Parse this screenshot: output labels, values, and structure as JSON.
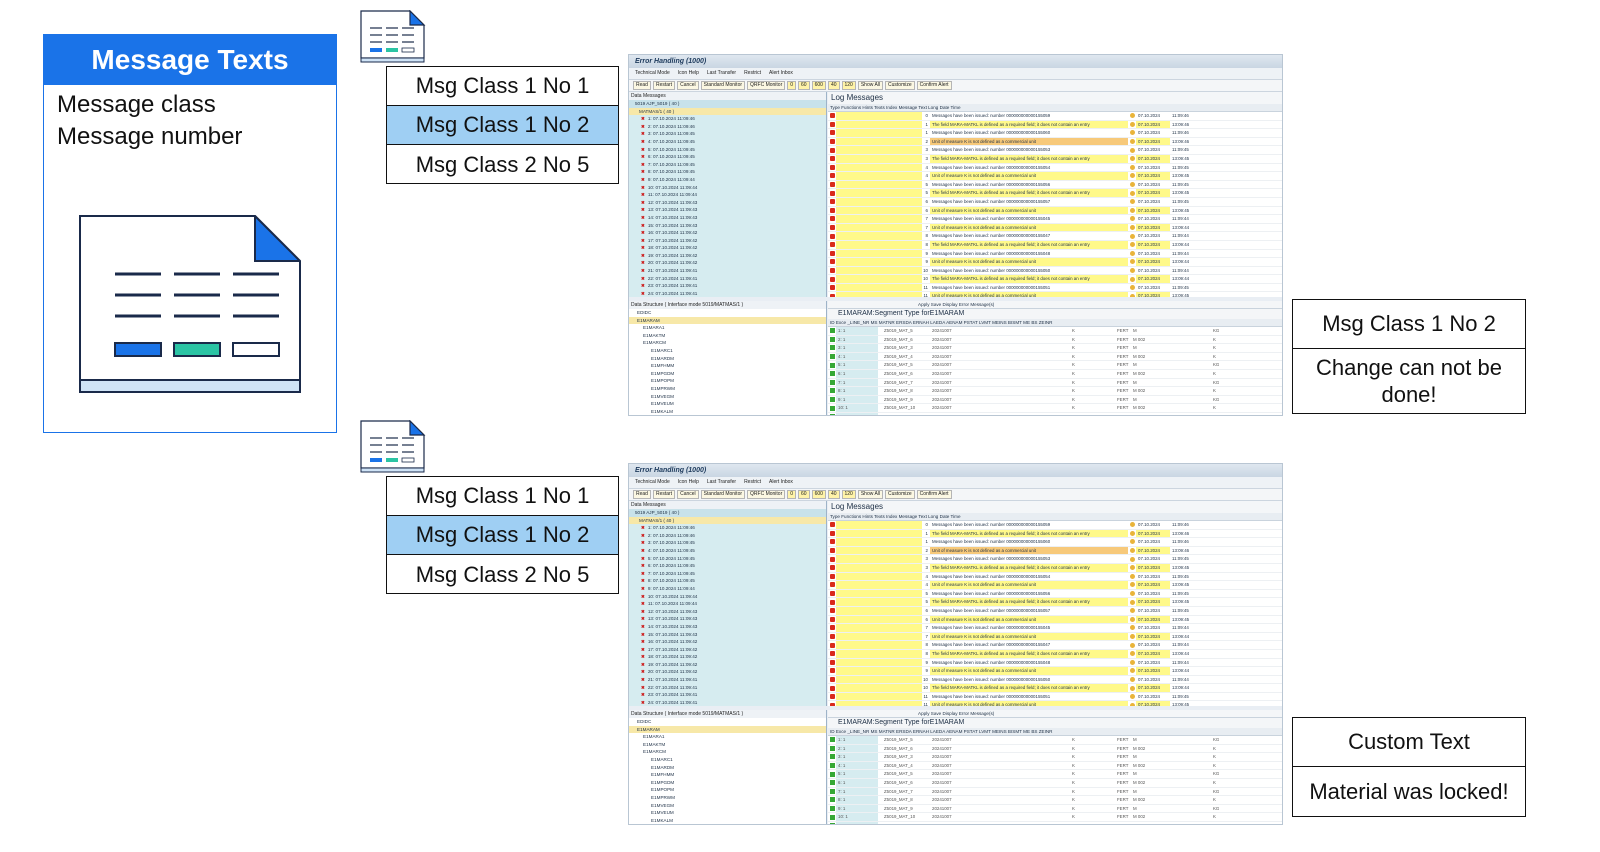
{
  "card": {
    "title": "Message Texts",
    "line1": "Message class",
    "line2": "Message number"
  },
  "lists": [
    {
      "items": [
        "Msg Class 1 No 1",
        "Msg Class 1 No 2",
        "Msg Class 2 No 5"
      ],
      "selected_index": 1
    },
    {
      "items": [
        "Msg Class 1 No 1",
        "Msg Class 1 No 2",
        "Msg Class 2 No 5"
      ],
      "selected_index": 1
    }
  ],
  "results": [
    {
      "top": "Msg Class 1 No 2",
      "bottom": "Change can not be done!"
    },
    {
      "top": "Custom Text",
      "bottom": "Material was locked!"
    }
  ],
  "sap": {
    "title": "Error Handling (1000)",
    "toolbar1": [
      "Technical Mode",
      "Icon Help",
      "Last Transfer",
      "Restrict",
      "Alert Inbox"
    ],
    "toolbar2": [
      "Read",
      "Restart",
      "Cancel",
      "Standard Monitor",
      "QRFC Monitor",
      "0",
      "60",
      "600",
      "40",
      "120",
      "Show All",
      "Customize",
      "Confirm Alert"
    ],
    "left_title": "Data Messages",
    "tree_root": "5019 AJP_5019 ( 40 )",
    "tree_child": "MATMAS/1 ( 40 )",
    "tree_items": [
      "1: 07.10.2024 11:09:46",
      "2: 07.10.2024 11:09:46",
      "3: 07.10.2024 11:09:45",
      "4: 07.10.2024 11:09:45",
      "5: 07.10.2024 11:09:45",
      "6: 07.10.2024 11:09:45",
      "7: 07.10.2024 11:09:45",
      "8: 07.10.2024 11:09:45",
      "9: 07.10.2024 11:09:44",
      "10: 07.10.2024 11:09:44",
      "11: 07.10.2024 11:09:44",
      "12: 07.10.2024 11:09:43",
      "13: 07.10.2024 11:09:43",
      "14: 07.10.2024 11:09:43",
      "15: 07.10.2024 11:09:43",
      "16: 07.10.2024 11:09:42",
      "17: 07.10.2024 11:09:42",
      "18: 07.10.2024 11:09:42",
      "19: 07.10.2024 11:09:42",
      "20: 07.10.2024 11:09:42",
      "21: 07.10.2024 11:09:41",
      "22: 07.10.2024 11:09:41",
      "23: 07.10.2024 11:09:41",
      "24: 07.10.2024 11:09:41"
    ],
    "log_title": "Log Messages",
    "log_header": "Type  Functions  Hints     Texts   Index  Message Text                                                                                   Long Date         Time",
    "log_rows": [
      [
        "0",
        "Messages have been issued: number 000000000000155059",
        "07.10.2024",
        "11:09:46",
        false
      ],
      [
        "1",
        "The field MARA-MATKL is defined as a required field; it does not contain an entry",
        "07.10.2024",
        "13:09:46",
        true
      ],
      [
        "1",
        "Messages have been issued: number 000000000000155060",
        "07.10.2024",
        "11:09:46",
        false
      ],
      [
        "2",
        "Unit of measure K is not defined as a commercial unit",
        "07.10.2024",
        "13:09:46",
        true
      ],
      [
        "3",
        "Messages have been issued: number 000000000000155053",
        "07.10.2024",
        "11:09:45",
        false
      ],
      [
        "3",
        "The field MARA-MATKL is defined as a required field; it does not contain an entry",
        "07.10.2024",
        "13:09:45",
        true
      ],
      [
        "4",
        "Messages have been issued: number 000000000000155054",
        "07.10.2024",
        "11:09:45",
        false
      ],
      [
        "4",
        "Unit of measure K is not defined as a commercial unit",
        "07.10.2024",
        "13:09:45",
        true
      ],
      [
        "5",
        "Messages have been issued: number 000000000000155056",
        "07.10.2024",
        "11:09:45",
        false
      ],
      [
        "5",
        "The field MARA-MATKL is defined as a required field; it does not contain an entry",
        "07.10.2024",
        "13:09:45",
        true
      ],
      [
        "6",
        "Messages have been issued: number 000000000000155057",
        "07.10.2024",
        "11:09:45",
        false
      ],
      [
        "6",
        "Unit of measure K is not defined as a commercial unit",
        "07.10.2024",
        "13:09:45",
        true
      ],
      [
        "7",
        "Messages have been issued: number 000000000000155045",
        "07.10.2024",
        "11:09:44",
        false
      ],
      [
        "7",
        "Unit of measure K is not defined as a commercial unit",
        "07.10.2024",
        "13:09:44",
        true
      ],
      [
        "8",
        "Messages have been issued: number 000000000000155047",
        "07.10.2024",
        "11:09:44",
        false
      ],
      [
        "8",
        "The field MARA-MATKL is defined as a required field; it does not contain an entry",
        "07.10.2024",
        "13:09:44",
        true
      ],
      [
        "9",
        "Messages have been issued: number 000000000000155048",
        "07.10.2024",
        "11:09:44",
        false
      ],
      [
        "9",
        "Unit of measure K is not defined as a commercial unit",
        "07.10.2024",
        "13:09:44",
        true
      ],
      [
        "10",
        "Messages have been issued: number 000000000000155050",
        "07.10.2024",
        "11:09:44",
        false
      ],
      [
        "10",
        "The field MARA-MATKL is defined as a required field; it does not contain an entry",
        "07.10.2024",
        "13:09:44",
        true
      ],
      [
        "11",
        "Messages have been issued: number 000000000000155051",
        "07.10.2024",
        "11:09:45",
        false
      ],
      [
        "11",
        "Unit of measure K is not defined as a commercial unit",
        "07.10.2024",
        "13:09:45",
        true
      ],
      [
        "12",
        "Messages have been issued: number 000000000000155039",
        "07.10.2024",
        "11:09:43",
        false
      ]
    ],
    "seg_toolbar": "Apply   Save   Display Error Message(s)",
    "seg_title": "E1MARAM:Segment Type forE1MARAM",
    "seg_header": "ID  Exce  _LINE_NR   MS  MATNR              ERSDA        ERNAH          LAEDA        AENAM          PSTAT            LVMT  MEINS             BISMT                              ME  BS  ZEINR",
    "seg_rows": [
      [
        "1: 1",
        "Z5019_MAT_5",
        "20241007",
        "K",
        "FERT",
        "M",
        "KG"
      ],
      [
        "2: 1",
        "Z5019_MAT_6",
        "20241007",
        "K",
        "FERT",
        "M  002",
        "K"
      ],
      [
        "3: 1",
        "Z5019_MAT_3",
        "20241007",
        "K",
        "FERT",
        "M",
        "K"
      ],
      [
        "4: 1",
        "Z5019_MAT_4",
        "20241007",
        "K",
        "FERT",
        "M  002",
        "K"
      ],
      [
        "5: 1",
        "Z5019_MAT_5",
        "20241007",
        "K",
        "FERT",
        "M",
        "KG"
      ],
      [
        "6: 1",
        "Z5019_MAT_6",
        "20241007",
        "K",
        "FERT",
        "M  002",
        "K"
      ],
      [
        "7: 1",
        "Z5019_MAT_7",
        "20241007",
        "K",
        "FERT",
        "M",
        "KG"
      ],
      [
        "8: 1",
        "Z5019_MAT_8",
        "20241007",
        "K",
        "FERT",
        "M  002",
        "K"
      ],
      [
        "9: 1",
        "Z5019_MAT_9",
        "20241007",
        "K",
        "FERT",
        "M",
        "KG"
      ],
      [
        "10: 1",
        "Z5019_MAT_10",
        "20241007",
        "K",
        "FERT",
        "M  002",
        "K"
      ],
      [
        "11: 1",
        "Z5019_MAT_11",
        "20241007",
        "K",
        "FERT",
        "M  002",
        "K"
      ]
    ],
    "struct_title": "Data Structure ( Interface mode 5019/MATMAS/1 )",
    "struct_items": [
      "EDIDC",
      "E1MARAM",
      "E1MARA1",
      "E1MAKTM",
      "E1MARCM",
      "E1MARC1",
      "E1MARDM",
      "E1MFHMM",
      "E1MPGDM",
      "E1MPOPM",
      "E1MPRWM",
      "E1MVEGM",
      "E1MVEUM",
      "E1MKALM"
    ]
  }
}
